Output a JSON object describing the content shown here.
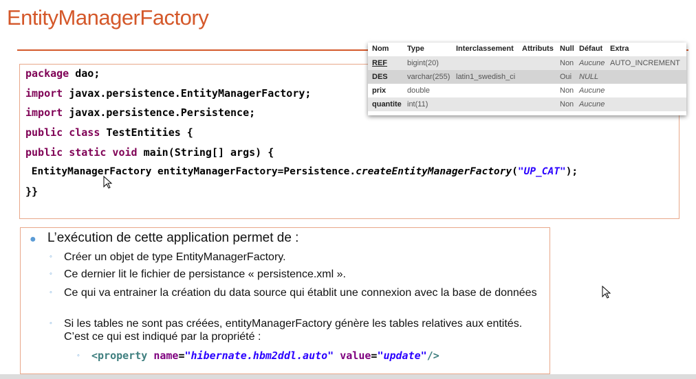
{
  "slide": {
    "title": "EntityManagerFactory"
  },
  "code": {
    "line1_kw": "package",
    "line1_rest": " dao;",
    "line2_kw": "import",
    "line2_rest": " javax.persistence.EntityManagerFactory;",
    "line3_kw": "import",
    "line3_rest": " javax.persistence.Persistence;",
    "line4_kw": "public class",
    "line4_rest": " TestEntities {",
    "line5_kw": "public static void",
    "line5_rest": " main(String[] args) {",
    "line6_a": " EntityManagerFactory entityManagerFactory=Persistence.",
    "line6_method": "createEntityManagerFactory",
    "line6_open": "(",
    "line6_str": "\"UP_CAT\"",
    "line6_close": ");",
    "line7": "}}"
  },
  "db_table": {
    "headers": [
      "Nom",
      "Type",
      "Interclassement",
      "Attributs",
      "Null",
      "Défaut",
      "Extra"
    ],
    "rows": [
      {
        "name": "REF",
        "type": "bigint(20)",
        "collation": "",
        "attributes": "",
        "null": "Non",
        "default": "Aucune",
        "extra": "AUTO_INCREMENT"
      },
      {
        "name": "DES",
        "type": "varchar(255)",
        "collation": "latin1_swedish_ci",
        "attributes": "",
        "null": "Oui",
        "default": "NULL",
        "extra": ""
      },
      {
        "name": "prix",
        "type": "double",
        "collation": "",
        "attributes": "",
        "null": "Non",
        "default": "Aucune",
        "extra": ""
      },
      {
        "name": "quantite",
        "type": "int(11)",
        "collation": "",
        "attributes": "",
        "null": "Non",
        "default": "Aucune",
        "extra": ""
      }
    ]
  },
  "bullets": {
    "main": "L’exécution de cette application permet de :",
    "sub1": "Créer un objet de type EntityManagerFactory.",
    "sub2": "Ce dernier lit le fichier de persistance « persistence.xml ».",
    "sub3": "Ce qui va entrainer la création du data source qui établit une connexion avec la base de données",
    "sub4": "Si les tables ne sont pas créées, entityManagerFactory génère les tables relatives aux entités. C’est ce qui est indiqué par la propriété :",
    "xml_open": "<property",
    "xml_attr1": "name",
    "xml_eq1": "=",
    "xml_val1": "\"hibernate.hbm2ddl.auto\"",
    "xml_attr2": "value",
    "xml_eq2": "=",
    "xml_val2": "\"update\"",
    "xml_close": "/>"
  },
  "colors": {
    "accent": "#d4582a",
    "bullet": "#5b9bd5",
    "keyword": "#7f0055",
    "string": "#2a00ff"
  }
}
